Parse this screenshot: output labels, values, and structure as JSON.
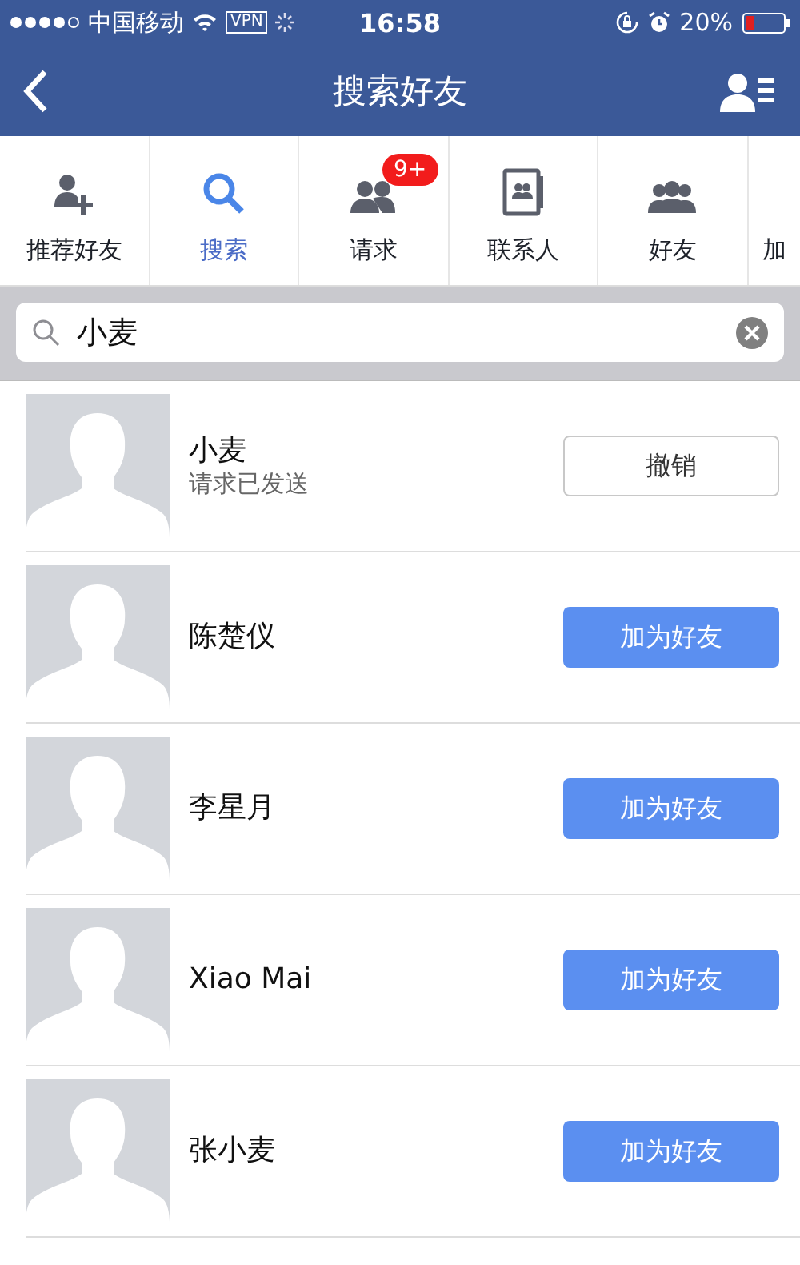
{
  "status_bar": {
    "carrier": "中国移动",
    "vpn": "VPN",
    "time": "16:58",
    "battery": "20%"
  },
  "nav": {
    "title": "搜索好友"
  },
  "tabs": [
    {
      "label": "推荐好友",
      "kind": "person-add",
      "selected": false
    },
    {
      "label": "搜索",
      "kind": "search",
      "selected": true
    },
    {
      "label": "请求",
      "kind": "people",
      "selected": false,
      "badge": "9+"
    },
    {
      "label": "联系人",
      "kind": "contacts",
      "selected": false
    },
    {
      "label": "好友",
      "kind": "group",
      "selected": false
    },
    {
      "label": "加",
      "kind": "more",
      "selected": false
    }
  ],
  "search": {
    "value": "小麦"
  },
  "results": [
    {
      "name": "小麦",
      "status": "请求已发送",
      "action": {
        "label": "撤销",
        "kind": "cancel"
      }
    },
    {
      "name": "陈楚仪",
      "action": {
        "label": "加为好友",
        "kind": "add"
      }
    },
    {
      "name": "李星月",
      "action": {
        "label": "加为好友",
        "kind": "add"
      }
    },
    {
      "name": "Xiao Mai",
      "action": {
        "label": "加为好友",
        "kind": "add"
      }
    },
    {
      "name": "张小麦",
      "action": {
        "label": "加为好友",
        "kind": "add"
      }
    }
  ]
}
